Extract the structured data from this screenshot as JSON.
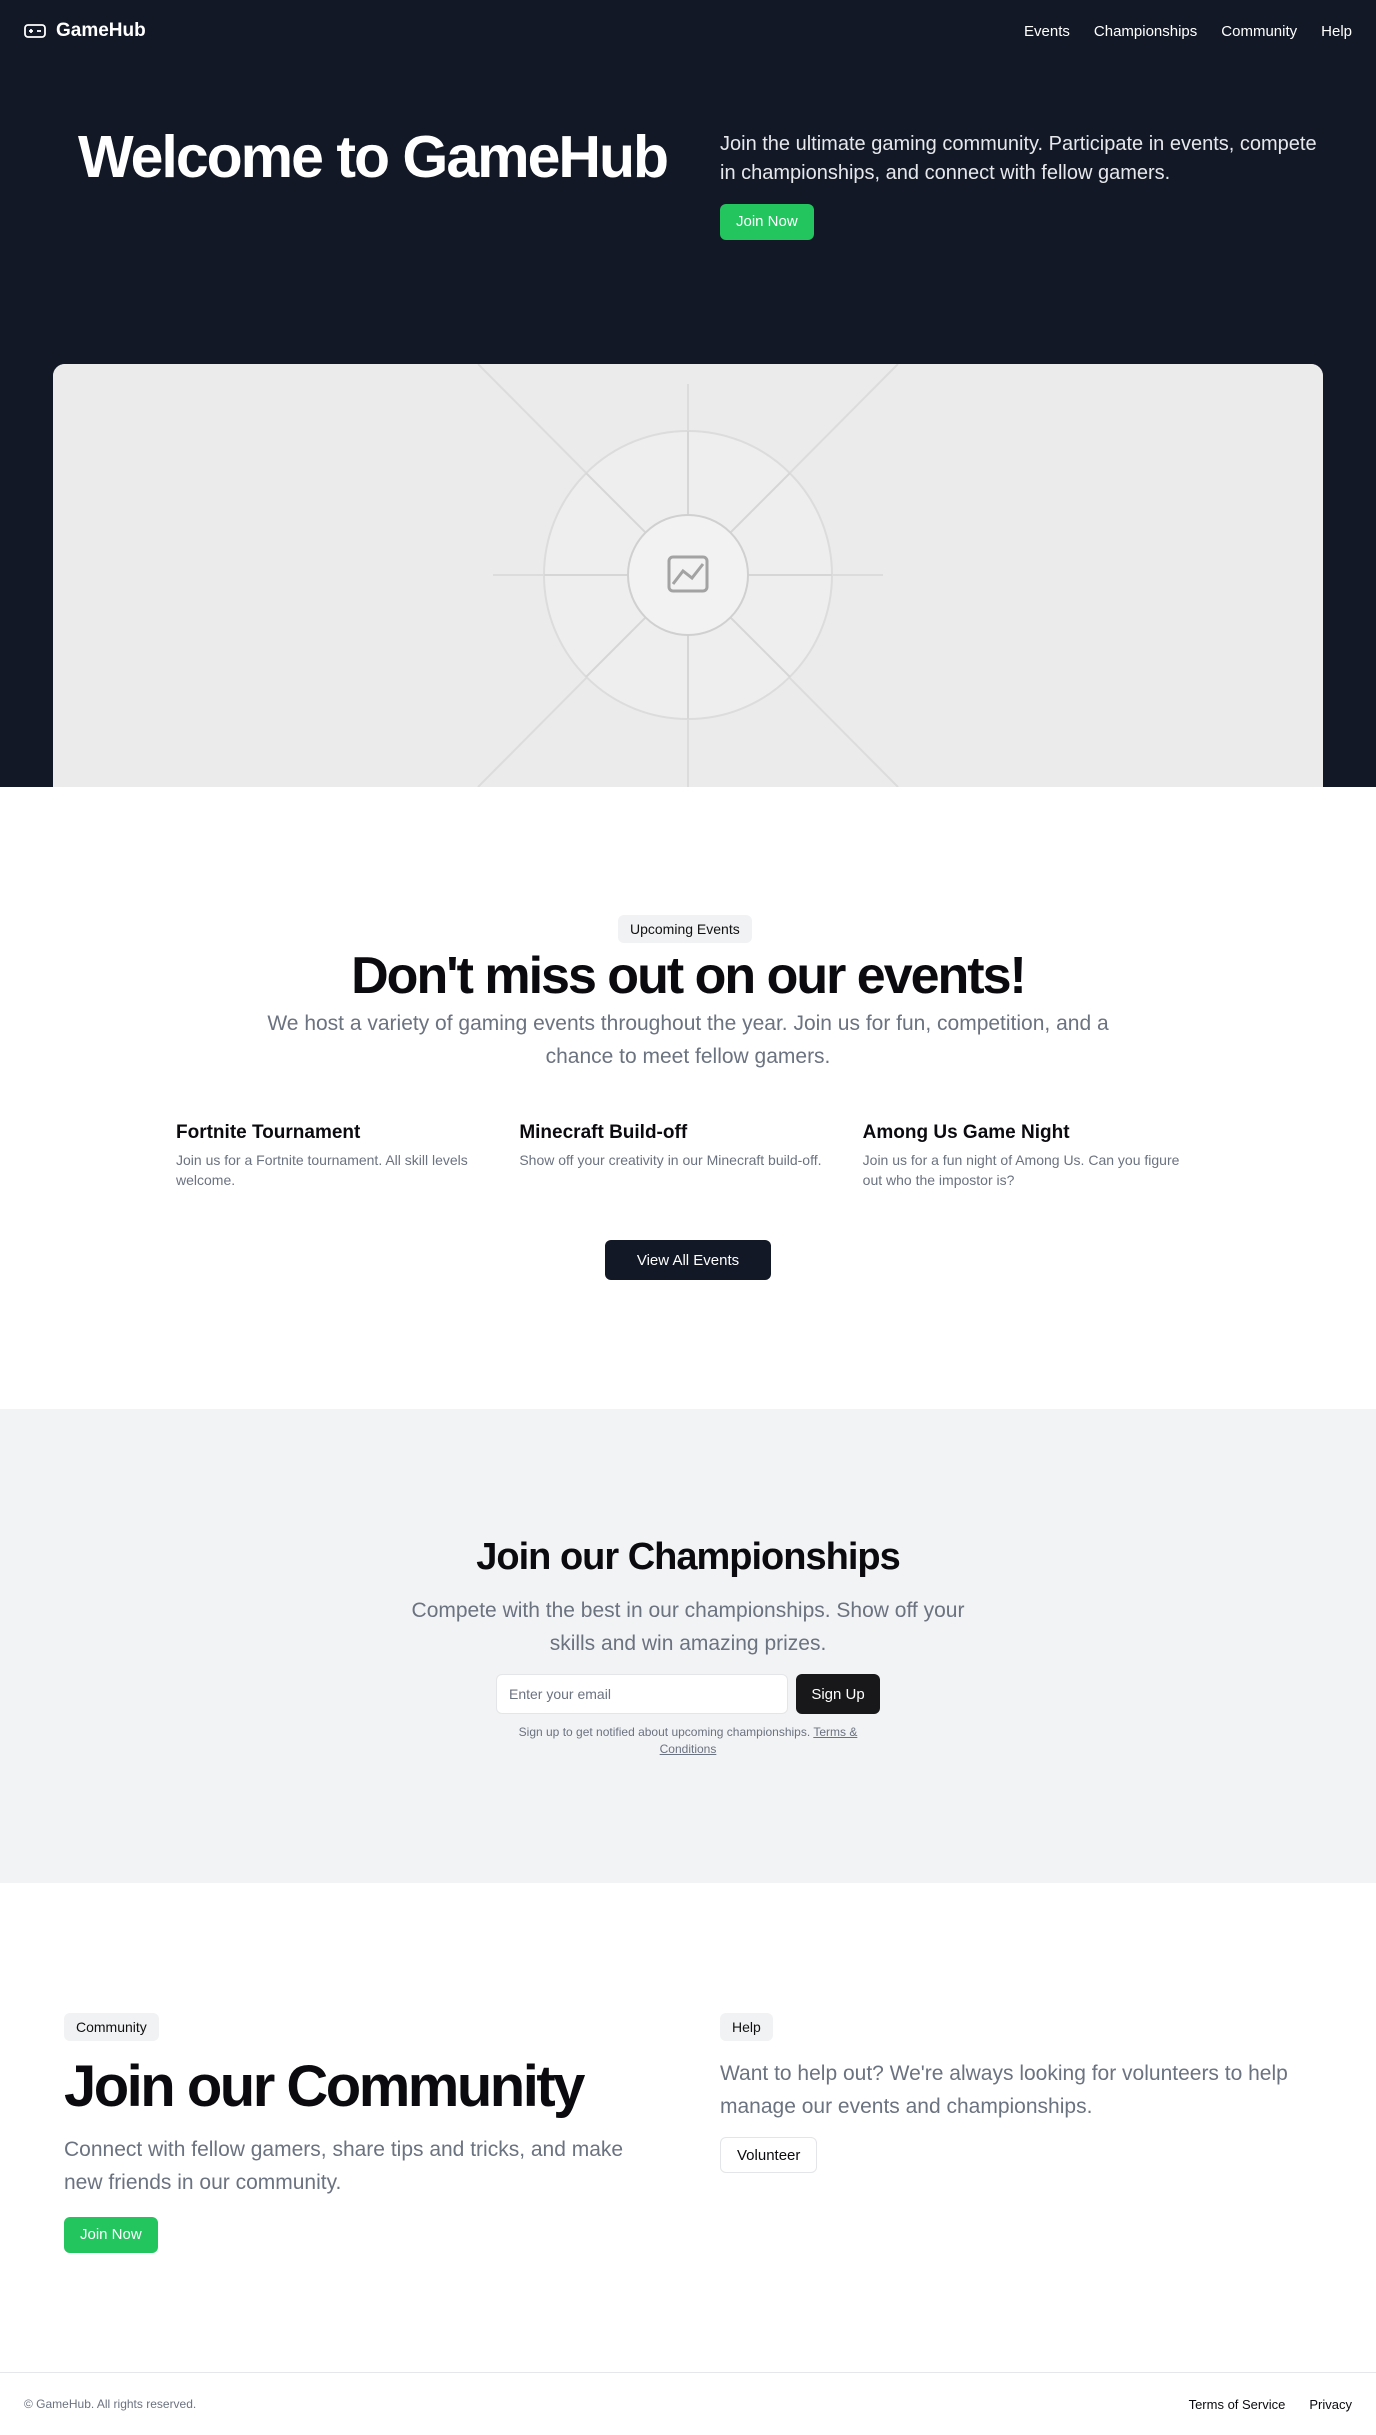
{
  "nav": {
    "brand": "GameHub",
    "links": [
      "Events",
      "Championships",
      "Community",
      "Help"
    ]
  },
  "hero": {
    "title": "Welcome to GameHub",
    "description": "Join the ultimate gaming community. Participate in events, compete in championships, and connect with fellow gamers.",
    "cta": "Join Now",
    "image_icon": "image-placeholder-icon"
  },
  "events": {
    "badge": "Upcoming Events",
    "title": "Don't miss out on our events!",
    "subtitle": "We host a variety of gaming events throughout the year. Join us for fun, competition, and a chance to meet fellow gamers.",
    "items": [
      {
        "title": "Fortnite Tournament",
        "description": "Join us for a Fortnite tournament. All skill levels welcome."
      },
      {
        "title": "Minecraft Build-off",
        "description": "Show off your creativity in our Minecraft build-off."
      },
      {
        "title": "Among Us Game Night",
        "description": "Join us for a fun night of Among Us. Can you figure out who the impostor is?"
      }
    ],
    "cta": "View All Events"
  },
  "championships": {
    "title": "Join our Championships",
    "subtitle": "Compete with the best in our championships. Show off your skills and win amazing prizes.",
    "email_placeholder": "Enter your email",
    "email_value": "",
    "cta": "Sign Up",
    "note": "Sign up to get notified about upcoming championships.",
    "terms_link": "Terms & Conditions"
  },
  "community": {
    "badge": "Community",
    "title": "Join our Community",
    "description": "Connect with fellow gamers, share tips and tricks, and make new friends in our community.",
    "cta": "Join Now"
  },
  "help": {
    "badge": "Help",
    "description": "Want to help out? We're always looking for volunteers to help manage our events and championships.",
    "cta": "Volunteer"
  },
  "footer": {
    "copyright": "© GameHub. All rights reserved.",
    "links": [
      "Terms of Service",
      "Privacy"
    ]
  },
  "colors": {
    "dark_bg": "#121826",
    "accent_green": "#22c55e",
    "muted_text": "#6b7280",
    "light_section": "#f2f3f5"
  }
}
